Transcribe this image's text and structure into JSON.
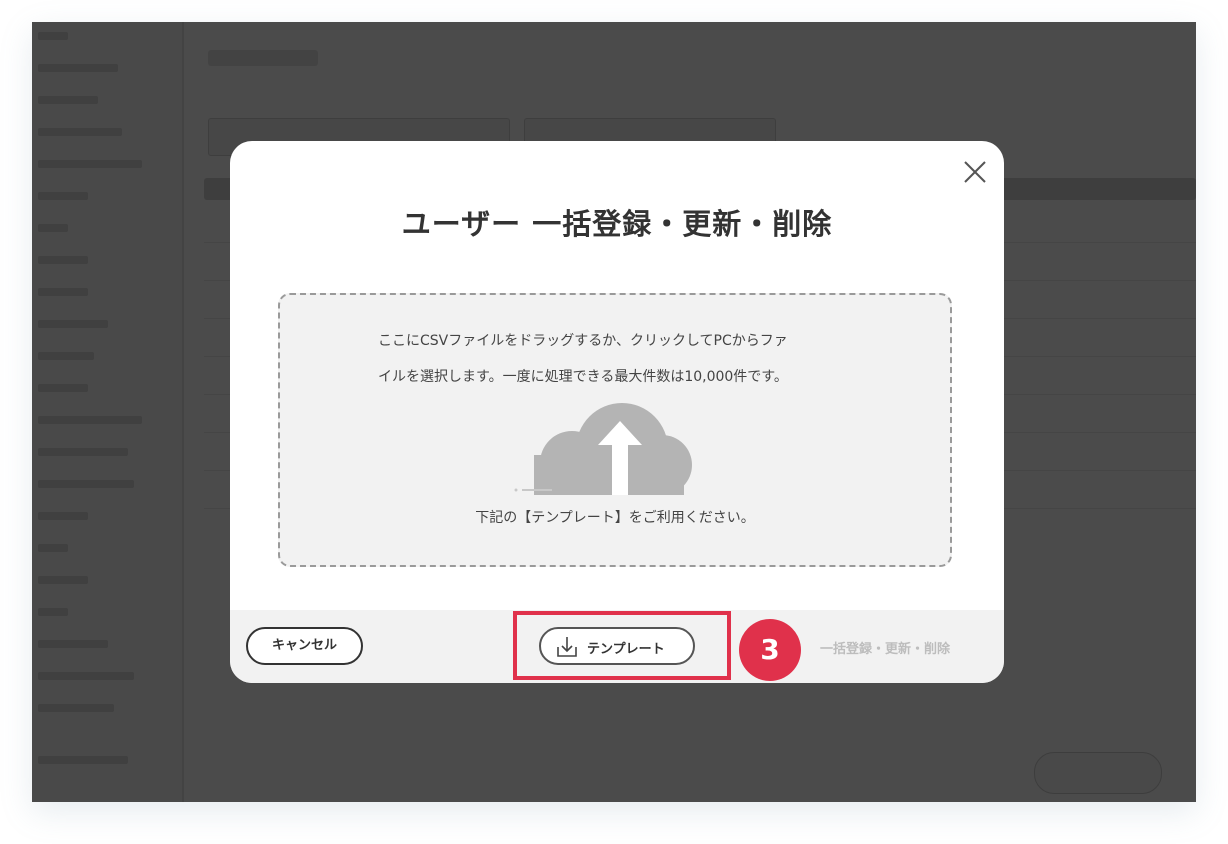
{
  "modal": {
    "title": "ユーザー 一括登録・更新・削除",
    "dropzone": {
      "line1": "ここにCSVファイルをドラッグするか、クリックしてPCからファ",
      "line2": "イルを選択します。一度に処理できる最大件数は10,000件です。",
      "note": "下記の【テンプレート】をご利用ください。",
      "icon": "cloud-upload-icon"
    },
    "footer": {
      "cancel_label": "キャンセル",
      "template_label": "テンプレート",
      "submit_label": "一括登録・更新・削除"
    },
    "close_icon": "close-icon"
  },
  "annotation": {
    "step_number": "3",
    "color": "#e0314b"
  },
  "colors": {
    "overlay": "rgba(0,0,0,0.70)",
    "title_text": "#333333",
    "dropzone_bg": "#f2f2f2",
    "cloud": "#b4b4b4",
    "disabled_text": "#bdbdbd"
  }
}
